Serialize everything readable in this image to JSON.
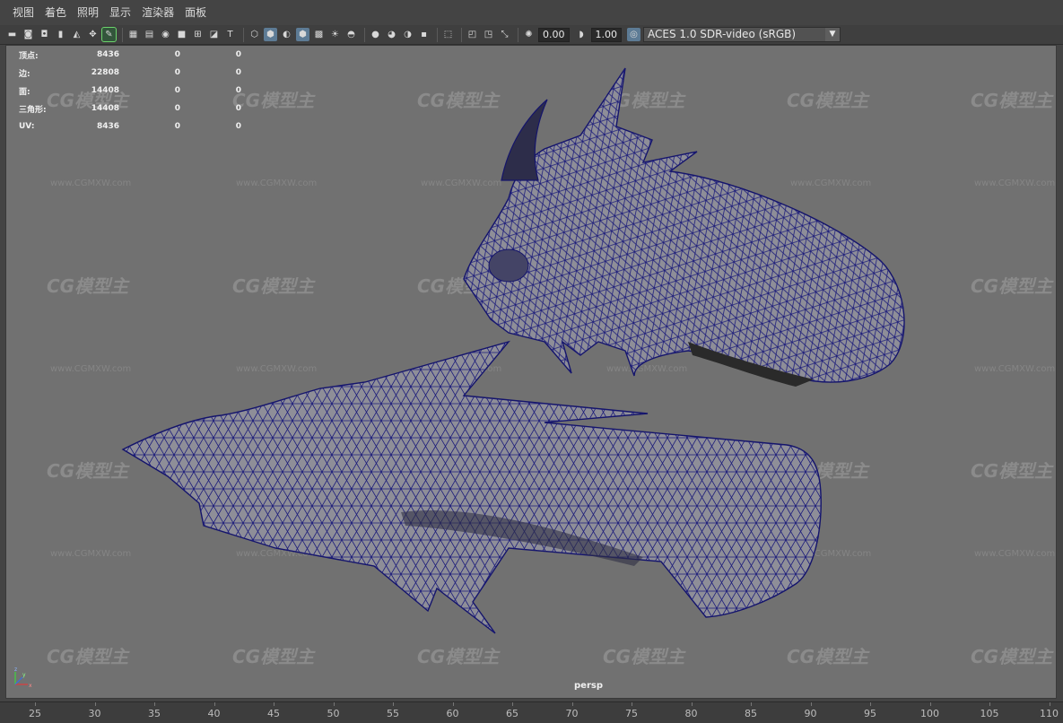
{
  "menu": [
    "视图",
    "着色",
    "照明",
    "显示",
    "渲染器",
    "面板"
  ],
  "toolbar": {
    "exposure_value": "0.00",
    "gamma_value": "1.00",
    "color_space": "ACES 1.0 SDR-video (sRGB)",
    "icons": [
      "camera-icon",
      "camera-attributes-icon",
      "bookmark-icon",
      "image-plane-icon",
      "pencil-icon",
      "grid-icon",
      "film-gate-icon",
      "resolution-gate-icon",
      "gate-mask-icon",
      "field-chart-icon",
      "safe-action-icon",
      "safe-title-icon",
      "wireframe-icon",
      "smooth-shade-icon",
      "texture-icon",
      "lights-icon",
      "shadows-icon",
      "ambient-occlusion-icon",
      "motion-blur-icon",
      "antialias-icon",
      "depth-of-field-icon",
      "isolate-select-icon",
      "xray-icon",
      "xray-joints-icon",
      "xray-components-icon"
    ]
  },
  "hud": {
    "rows": [
      {
        "label": "顶点:",
        "v1": "8436",
        "v2": "0",
        "v3": "0"
      },
      {
        "label": "边:",
        "v1": "22808",
        "v2": "0",
        "v3": "0"
      },
      {
        "label": "面:",
        "v1": "14408",
        "v2": "0",
        "v3": "0"
      },
      {
        "label": "三角形:",
        "v1": "14408",
        "v2": "0",
        "v3": "0"
      },
      {
        "label": "UV:",
        "v1": "8436",
        "v2": "0",
        "v3": "0"
      }
    ]
  },
  "viewport": {
    "camera_label": "persp",
    "watermark_text": "CG模型主",
    "watermark_url": "www.CGMXW.com",
    "background": "#717171",
    "wireframe_color": "#1b1b7a",
    "mesh_fill": "#8c8c96"
  },
  "axis": {
    "z": "z",
    "y": "y",
    "x": "x"
  },
  "timeline": {
    "ticks": [
      "25",
      "30",
      "35",
      "40",
      "45",
      "50",
      "55",
      "60",
      "65",
      "70",
      "75",
      "80",
      "85",
      "90",
      "95",
      "100",
      "105",
      "110"
    ]
  }
}
